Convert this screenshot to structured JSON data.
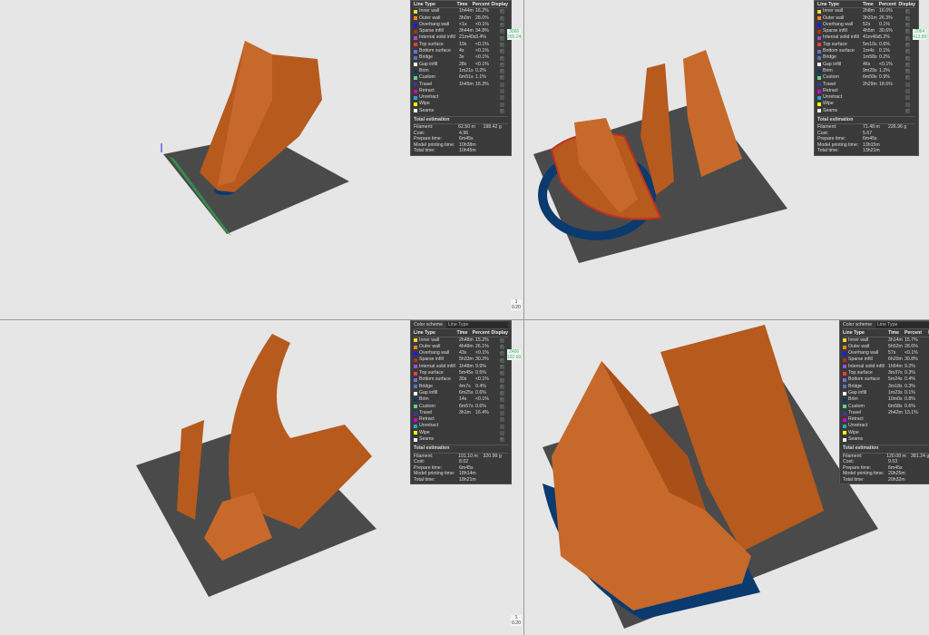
{
  "columns": {
    "line_type": "Line Type",
    "time": "Time",
    "percent": "Percent",
    "display": "Display",
    "display_short": "D"
  },
  "color_scheme": {
    "label": "Color scheme",
    "value": "Line Type"
  },
  "total_heading": "Total estimation",
  "total_labels": {
    "filament": "Filament:",
    "cost": "Cost:",
    "prepare": "Prepare time:",
    "model": "Model printing time:",
    "total": "Total time:"
  },
  "line_types": [
    {
      "name": "Inner wall",
      "color": "#f5d82a"
    },
    {
      "name": "Outer wall",
      "color": "#ff7f27"
    },
    {
      "name": "Overhang wall",
      "color": "#1a1aff"
    },
    {
      "name": "Sparse infill",
      "color": "#b03029"
    },
    {
      "name": "Internal solid infill",
      "color": "#9654cc"
    },
    {
      "name": "Top surface",
      "color": "#f03c3c"
    },
    {
      "name": "Bottom surface",
      "color": "#6e6edc"
    },
    {
      "name": "Bridge",
      "color": "#4f78b8"
    },
    {
      "name": "Gap infill",
      "color": "#ffffff"
    },
    {
      "name": "Brim",
      "color": "#0a3a6e"
    },
    {
      "name": "Custom",
      "color": "#5ed194"
    },
    {
      "name": "Travel",
      "color": "#3a3a9a"
    },
    {
      "name": "Retract",
      "color": "#cc00cc"
    },
    {
      "name": "Unretract",
      "color": "#26a6cc"
    },
    {
      "name": "Wipe",
      "color": "#ffff00"
    },
    {
      "name": "Seams",
      "color": "#f0f0f0"
    }
  ],
  "display_checked": [
    true,
    true,
    true,
    true,
    true,
    true,
    true,
    true,
    true,
    true,
    true,
    false,
    false,
    false,
    false,
    true
  ],
  "panes": [
    {
      "show_color_scheme": false,
      "show_display": true,
      "rows": [
        [
          "1h44m",
          "16.2%"
        ],
        [
          "3h0m",
          "28.0%"
        ],
        [
          "<1s",
          "<0.1%"
        ],
        [
          "3h44m",
          "34.8%"
        ],
        [
          "21m40s",
          "3.4%"
        ],
        [
          "19s",
          "<0.1%"
        ],
        [
          "4s",
          "<0.1%"
        ],
        [
          "3s",
          "<0.1%"
        ],
        [
          "28s",
          "<0.1%"
        ],
        [
          "1m21s",
          "0.2%"
        ],
        [
          "6m51s",
          "1.1%"
        ],
        [
          "1h45m",
          "16.3%"
        ]
      ],
      "totals": {
        "filament": "62.50 m",
        "weight": "198.42 g",
        "cost": "4.96",
        "prepare": "6m45s",
        "model": "10h38m",
        "total": "10h45m"
      },
      "readout": [
        "3066",
        "265.24"
      ],
      "bottom": [
        "1",
        "0.20"
      ]
    },
    {
      "show_color_scheme": false,
      "show_display": true,
      "rows": [
        [
          "2h8m",
          "16.0%"
        ],
        [
          "3h31m",
          "26.3%"
        ],
        [
          "52s",
          "0.1%"
        ],
        [
          "4h5m",
          "30.6%"
        ],
        [
          "41m46s",
          "5.2%"
        ],
        [
          "5m10s",
          "0.6%"
        ],
        [
          "1m4s",
          "0.1%"
        ],
        [
          "1m58s",
          "0.2%"
        ],
        [
          "46s",
          "<0.1%"
        ],
        [
          "9m29s",
          "1.2%"
        ],
        [
          "6m59s",
          "0.9%"
        ],
        [
          "2h29m",
          "18.6%"
        ]
      ],
      "totals": {
        "filament": "71.48 m",
        "weight": "226.96 g",
        "cost": "5.67",
        "prepare": "6m45s",
        "model": "13h15m",
        "total": "13h21m"
      },
      "readout": [
        "2064",
        "413.80"
      ],
      "bottom": []
    },
    {
      "show_color_scheme": true,
      "show_display": true,
      "rows": [
        [
          "2h48m",
          "15.2%"
        ],
        [
          "4h48m",
          "26.1%"
        ],
        [
          "43s",
          "<0.1%"
        ],
        [
          "5h33m",
          "30.2%"
        ],
        [
          "1h48m",
          "9.9%"
        ],
        [
          "5m45s",
          "0.5%"
        ],
        [
          "30s",
          "<0.1%"
        ],
        [
          "4m7s",
          "0.4%"
        ],
        [
          "6m25s",
          "0.6%"
        ],
        [
          "14s",
          "<0.1%"
        ],
        [
          "6m57s",
          "0.6%"
        ],
        [
          "3h1m",
          "16.4%"
        ]
      ],
      "totals": {
        "filament": "101.10 m",
        "weight": "320.99 g",
        "cost": "8.02",
        "prepare": "6m45s",
        "model": "18h14m",
        "total": "18h21m"
      },
      "readout": [
        "2406",
        "192.60"
      ],
      "bottom": [
        "1",
        "0.20"
      ]
    },
    {
      "show_color_scheme": true,
      "show_display": false,
      "rows": [
        [
          "3h14m",
          "15.7%"
        ],
        [
          "5h52m",
          "28.6%"
        ],
        [
          "57s",
          "<0.1%"
        ],
        [
          "6h20m",
          "30.8%"
        ],
        [
          "1h54m",
          "9.2%"
        ],
        [
          "3m37s",
          "0.3%"
        ],
        [
          "5m24s",
          "0.4%"
        ],
        [
          "3m18s",
          "0.3%"
        ],
        [
          "1m23s",
          "0.1%"
        ],
        [
          "10m0s",
          "0.8%"
        ],
        [
          "6m58s",
          "0.6%"
        ],
        [
          "2h42m",
          "13.1%"
        ]
      ],
      "totals": {
        "filament": "120.08 m",
        "weight": "381.24 g",
        "cost": "9.53",
        "prepare": "6m45s",
        "model": "20h25m",
        "total": "20h32m"
      },
      "readout": [],
      "bottom": []
    }
  ]
}
